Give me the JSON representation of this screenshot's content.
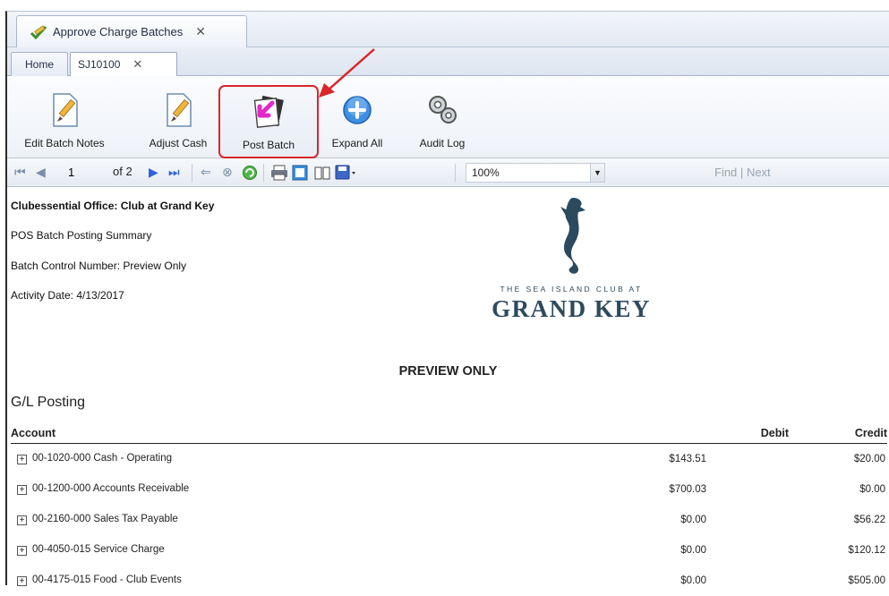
{
  "window_tab": {
    "title": "Approve Charge Batches",
    "close": "✕"
  },
  "sub_tabs": [
    {
      "label": "Home"
    },
    {
      "label": "SJ10100",
      "close": "✕"
    }
  ],
  "ribbon": {
    "edit_batch_notes": "Edit Batch Notes",
    "adjust_cash": "Adjust Cash",
    "post_batch": "Post Batch",
    "expand_all": "Expand All",
    "audit_log": "Audit Log"
  },
  "report_toolbar": {
    "current_page": "1",
    "page_total": "of 2",
    "zoom": "100%",
    "find": "Find",
    "separator": "|",
    "next": "Next"
  },
  "report": {
    "club_name": "Clubessential Office: Club at Grand Key",
    "report_title": "POS Batch Posting Summary",
    "batch_control": "Batch Control Number: Preview Only",
    "activity_date": "Activity Date: 4/13/2017",
    "logo_tagline": "THE SEA ISLAND CLUB AT",
    "logo_brand": "GRAND KEY",
    "preview_label": "PREVIEW ONLY",
    "section_title": "G/L Posting",
    "columns": {
      "account": "Account",
      "debit": "Debit",
      "credit": "Credit"
    },
    "rows": [
      {
        "account": "00-1020-000 Cash - Operating",
        "debit": "$143.51",
        "credit": "$20.00"
      },
      {
        "account": "00-1200-000 Accounts Receivable",
        "debit": "$700.03",
        "credit": "$0.00"
      },
      {
        "account": "00-2160-000 Sales Tax Payable",
        "debit": "$0.00",
        "credit": "$56.22"
      },
      {
        "account": "00-4050-015 Service Charge",
        "debit": "$0.00",
        "credit": "$120.12"
      },
      {
        "account": "00-4175-015 Food - Club Events",
        "debit": "$0.00",
        "credit": "$505.00"
      }
    ]
  },
  "colors": {
    "highlight_red": "#d9262b",
    "nav_blue": "#2f64d8",
    "logo_navy": "#2c4a5e"
  }
}
